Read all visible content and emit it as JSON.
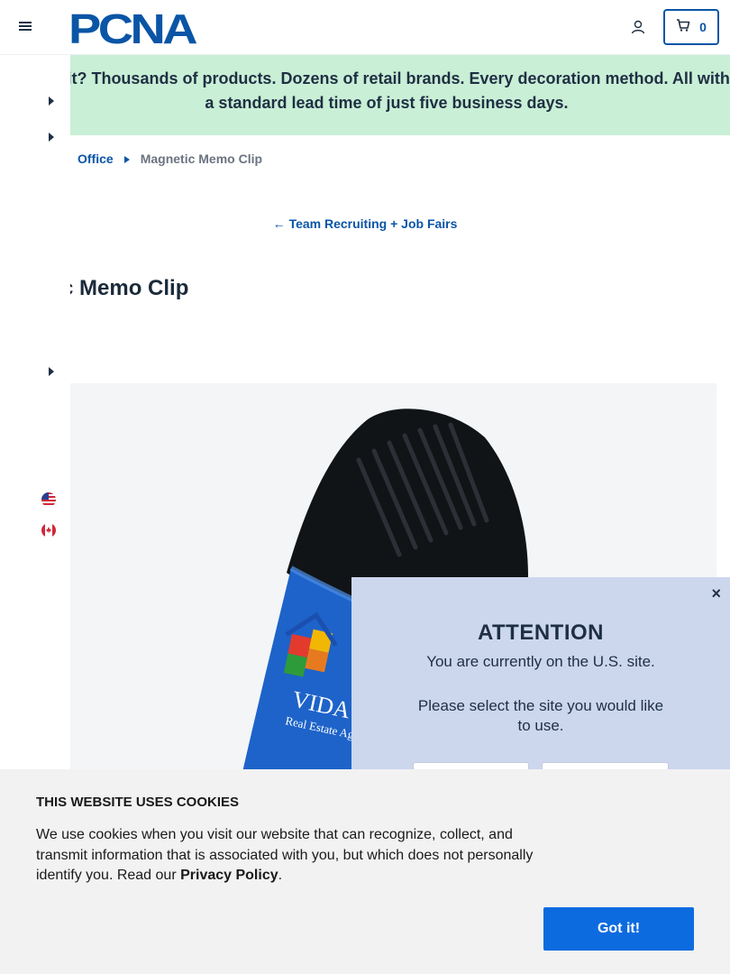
{
  "header": {
    "logo_text": "PCNA",
    "cart_count": "0"
  },
  "banner": {
    "text": "Wait? Thousands of products. Dozens of retail brands. Every decoration method. All with a standard lead time of just five business days."
  },
  "breadcrumb": {
    "parent": "Office",
    "current": "Magnetic Memo Clip"
  },
  "back_link": {
    "arrow": "←",
    "label": "Team Recruiting + Job Fairs"
  },
  "product": {
    "title": "etic Memo Clip",
    "imprint_brand": "VIDA",
    "imprint_tagline": "Real Estate Agents"
  },
  "modal": {
    "title": "ATTENTION",
    "line1": "You are currently on the U.S. site.",
    "line2": "Please select the site you would like to use.",
    "close": "×"
  },
  "cookie": {
    "title": "THIS WEBSITE USES COOKIES",
    "text_before": "We use cookies when you visit our website that can recognize, collect, and transmit information that is associated with you, but which does not personally identify you. Read our ",
    "link": "Privacy Policy",
    "text_after": ".",
    "button": "Got it!"
  },
  "colors": {
    "brand_blue": "#0a55a6",
    "banner_green": "#c9efd6",
    "modal_bg": "#ccd7ee",
    "cookie_button": "#0d6be0"
  },
  "icons": [
    "menu-icon",
    "account-icon",
    "cart-icon",
    "caret-right-icon",
    "us-flag-icon",
    "canada-flag-icon",
    "close-icon",
    "arrow-left-icon"
  ]
}
